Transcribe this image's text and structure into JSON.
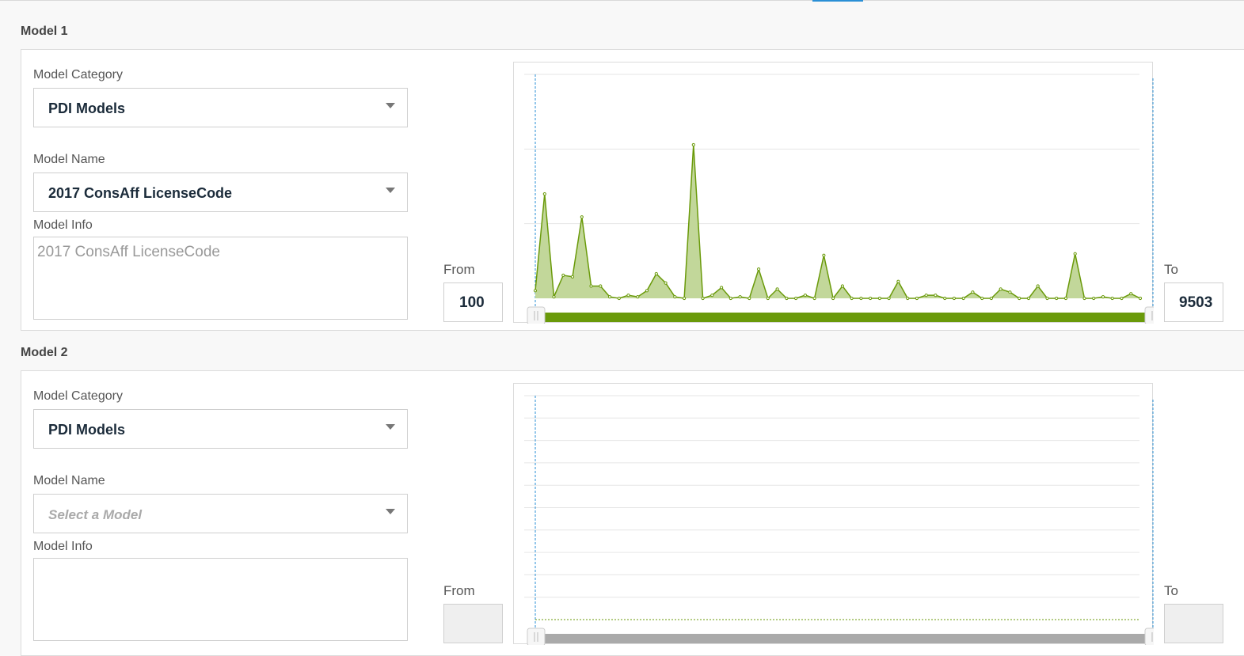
{
  "models": [
    {
      "title": "Model 1",
      "category_label": "Model Category",
      "category_value": "PDI Models",
      "name_label": "Model Name",
      "name_value": "2017 ConsAff LicenseCode",
      "name_placeholder": "",
      "info_label": "Model Info",
      "info_text": "2017 ConsAff LicenseCode",
      "from_label": "From",
      "from_value": "100",
      "to_label": "To",
      "to_value": "9503"
    },
    {
      "title": "Model 2",
      "category_label": "Model Category",
      "category_value": "PDI Models",
      "name_label": "Model Name",
      "name_value": "",
      "name_placeholder": "Select a Model",
      "info_label": "Model Info",
      "info_text": "",
      "from_label": "From",
      "from_value": "",
      "to_label": "To",
      "to_value": ""
    }
  ],
  "colors": {
    "series": "#6a9a0a",
    "series_fill": "#c2d79a",
    "slider_active": "#6a9a0a",
    "slider_inactive": "#aaaaaa",
    "marker_line": "#2a8fd6"
  },
  "chart_data": [
    {
      "type": "area",
      "title": "",
      "xlabel": "",
      "ylabel": "",
      "grid": true,
      "range_selector": {
        "from": 100,
        "to": 9503
      },
      "series": [
        {
          "values": [
            0.05,
            0.68,
            0.01,
            0.15,
            0.14,
            0.53,
            0.08,
            0.08,
            0.01,
            0.0,
            0.02,
            0.01,
            0.05,
            0.16,
            0.1,
            0.01,
            0.0,
            1.0,
            0.0,
            0.02,
            0.07,
            0.0,
            0.01,
            0.0,
            0.19,
            0.0,
            0.06,
            0.0,
            0.0,
            0.02,
            0.0,
            0.28,
            0.0,
            0.08,
            0.0,
            0.0,
            0.0,
            0.0,
            0.0,
            0.11,
            0.0,
            0.0,
            0.02,
            0.02,
            0.0,
            0.0,
            0.0,
            0.04,
            0.0,
            0.0,
            0.06,
            0.04,
            0.0,
            0.0,
            0.08,
            0.0,
            0.0,
            0.0,
            0.29,
            0.0,
            0.0,
            0.01,
            0.0,
            0.0,
            0.03,
            0.0
          ]
        }
      ]
    },
    {
      "type": "area",
      "title": "",
      "xlabel": "",
      "ylabel": "",
      "grid": true,
      "series": [
        {
          "values": [
            0,
            0,
            0,
            0,
            0,
            0,
            0,
            0,
            0,
            0,
            0,
            0,
            0,
            0,
            0,
            0,
            0,
            0,
            0,
            0
          ]
        }
      ]
    }
  ]
}
